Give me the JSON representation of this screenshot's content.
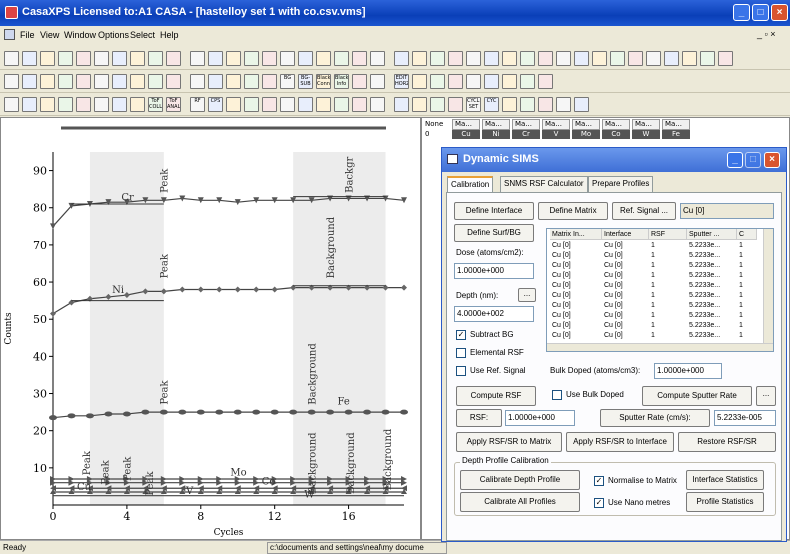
{
  "window": {
    "title": "CasaXPS Licensed to:A1 CASA - [hastelloy set 1 with co.csv.vms]"
  },
  "menu": [
    "File",
    "View",
    "Window",
    "Options",
    "Select",
    "Help"
  ],
  "status": {
    "left": "Ready",
    "path": "c:\\documents and settings\\neal\\my docume"
  },
  "toolbar_text": {
    "rsf": "RF",
    "cps": "CPS",
    "bg": "BG",
    "bgsub": "BG-SUB",
    "black_conn": "Black Conn",
    "black_info": "Black Info",
    "edit_horz": "EDIT HORZ",
    "tof_coll": "ToF COLL",
    "tof_anal": "ToF ANAL",
    "cycle_set": "CYCLE SET",
    "cyc": "CYC"
  },
  "colors": {
    "accent": "#0a3fb8",
    "chart_band": "#ececec",
    "line": "#555555"
  },
  "data_table": {
    "row_label": "None",
    "row_index": "0",
    "columns": [
      {
        "header": "Ma...",
        "sub": "Cu"
      },
      {
        "header": "Ma...",
        "sub": "Ni"
      },
      {
        "header": "Ma...",
        "sub": "Cr"
      },
      {
        "header": "Ma...",
        "sub": "V"
      },
      {
        "header": "Ma...",
        "sub": "Mo"
      },
      {
        "header": "Ma...",
        "sub": "Co"
      },
      {
        "header": "Ma...",
        "sub": "W"
      },
      {
        "header": "Ma...",
        "sub": "Fe"
      }
    ]
  },
  "dialog": {
    "title": "Dynamic SIMS",
    "tabs": [
      "Calibration",
      "SNMS RSF Calculator",
      "Prepare Profiles"
    ],
    "buttons": {
      "define_interface": "Define Interface",
      "define_matrix": "Define Matrix",
      "ref_signal": "Ref. Signal ...",
      "define_surf_bg": "Define Surf/BG",
      "depth_more": "...",
      "compute_rsf": "Compute RSF",
      "compute_sputter": "Compute Sputter Rate",
      "more": "...",
      "rsf": "RSF:",
      "apply_matrix": "Apply RSF/SR to Matrix",
      "apply_interface": "Apply RSF/SR to Interface",
      "restore": "Restore RSF/SR",
      "calibrate_depth": "Calibrate Depth Profile",
      "calibrate_all": "Calibrate All Profiles",
      "interface_stats": "Interface Statistics",
      "profile_stats": "Profile Statistics"
    },
    "ref_signal_value": "Cu [0]",
    "dose_label": "Dose (atoms/cm2):",
    "dose_value": "1.0000e+000",
    "depth_label": "Depth (nm):",
    "depth_value": "4.0000e+002",
    "checks": {
      "subtract_bg": "Subtract BG",
      "elemental_rsf": "Elemental RSF",
      "use_ref_signal": "Use Ref. Signal",
      "use_bulk_doped": "Use Bulk Doped",
      "normalise": "Normalise to Matrix",
      "nano": "Use Nano metres"
    },
    "check_states": {
      "subtract_bg": "✓",
      "elemental_rsf": "",
      "use_ref_signal": "",
      "use_bulk_doped": "",
      "normalise": "✓",
      "nano": "✓"
    },
    "bulk_label": "Bulk Doped (atoms/cm3):",
    "bulk_value": "1.0000e+000",
    "rsf_value": "1.0000e+000",
    "sputter_label": "Sputter Rate (cm/s):",
    "sputter_value": "5.2233e-005",
    "group_label": "Depth Profile Calibration",
    "table": {
      "headers": [
        "Matrix In...",
        "Interface",
        "RSF",
        "Sputter ...",
        "C"
      ],
      "rows": [
        [
          "Cu [0]",
          "Cu [0]",
          "1",
          "5.2233e...",
          "1"
        ],
        [
          "Cu [0]",
          "Cu [0]",
          "1",
          "5.2233e...",
          "1"
        ],
        [
          "Cu [0]",
          "Cu [0]",
          "1",
          "5.2233e...",
          "1"
        ],
        [
          "Cu [0]",
          "Cu [0]",
          "1",
          "5.2233e...",
          "1"
        ],
        [
          "Cu [0]",
          "Cu [0]",
          "1",
          "5.2233e...",
          "1"
        ],
        [
          "Cu [0]",
          "Cu [0]",
          "1",
          "5.2233e...",
          "1"
        ],
        [
          "Cu [0]",
          "Cu [0]",
          "1",
          "5.2233e...",
          "1"
        ],
        [
          "Cu [0]",
          "Cu [0]",
          "1",
          "5.2233e...",
          "1"
        ],
        [
          "Cu [0]",
          "Cu [0]",
          "1",
          "5.2233e...",
          "1"
        ],
        [
          "Cu [0]",
          "Cu [0]",
          "1",
          "5.2233e...",
          "1"
        ]
      ]
    }
  },
  "chart_data": {
    "type": "line",
    "title": "",
    "xlabel": "Cycles",
    "ylabel": "Counts",
    "xlim": [
      0,
      19
    ],
    "ylim": [
      0,
      95
    ],
    "xticks": [
      0,
      4,
      8,
      12,
      16
    ],
    "yticks": [
      10,
      20,
      30,
      40,
      50,
      60,
      70,
      80,
      90
    ],
    "bands": [
      [
        2,
        6
      ],
      [
        13,
        18
      ]
    ],
    "series": [
      {
        "name": "Cr",
        "marker": "triangle-down",
        "x": [
          0,
          1,
          2,
          3,
          4,
          5,
          6,
          7,
          8,
          9,
          10,
          11,
          12,
          13,
          14,
          15,
          16,
          17,
          18,
          19
        ],
        "values": [
          75,
          80.5,
          81,
          81.5,
          81.5,
          82,
          82,
          82.5,
          82,
          82,
          81.5,
          82,
          82,
          82,
          82,
          82.5,
          82.5,
          82.5,
          82.5,
          82
        ]
      },
      {
        "name": "Ni",
        "marker": "diamond",
        "x": [
          0,
          1,
          2,
          3,
          4,
          5,
          6,
          7,
          8,
          9,
          10,
          11,
          12,
          13,
          14,
          15,
          16,
          17,
          18,
          19
        ],
        "values": [
          51.5,
          54.5,
          55.5,
          56,
          56.5,
          57.5,
          57.5,
          58,
          58,
          58,
          58,
          58,
          58,
          58.5,
          58.5,
          58.5,
          58.5,
          58.5,
          58.5,
          58.5
        ]
      },
      {
        "name": "Fe",
        "marker": "dot",
        "x": [
          0,
          1,
          2,
          3,
          4,
          5,
          6,
          7,
          8,
          9,
          10,
          11,
          12,
          13,
          14,
          15,
          16,
          17,
          18,
          19
        ],
        "values": [
          23.5,
          24,
          24,
          24.5,
          24.5,
          25,
          25,
          25,
          25,
          25,
          25,
          25,
          25,
          25,
          25,
          25,
          25,
          25,
          25,
          25
        ]
      },
      {
        "name": "Mo",
        "marker": "triangle-right",
        "x": [
          0,
          1,
          2,
          3,
          4,
          5,
          6,
          7,
          8,
          9,
          10,
          11,
          12,
          13,
          14,
          15,
          16,
          17,
          18,
          19
        ],
        "values": [
          7,
          7,
          7,
          7,
          7,
          7,
          7,
          7,
          7,
          7,
          7,
          7,
          7,
          7,
          7,
          7,
          7,
          7,
          7,
          7
        ]
      },
      {
        "name": "Co",
        "marker": "triangle-right",
        "x": [
          0,
          1,
          2,
          3,
          4,
          5,
          6,
          7,
          8,
          9,
          10,
          11,
          12,
          13,
          14,
          15,
          16,
          17,
          18,
          19
        ],
        "values": [
          6,
          6,
          6,
          6,
          6,
          6,
          6,
          6,
          6,
          6,
          6,
          6,
          6,
          6,
          6,
          6,
          6,
          6,
          6,
          6
        ]
      },
      {
        "name": "Cu",
        "marker": "triangle-left",
        "x": [
          0,
          1,
          2,
          3,
          4,
          5,
          6,
          7,
          8,
          9,
          10,
          11,
          12,
          13,
          14,
          15,
          16,
          17,
          18,
          19
        ],
        "values": [
          4.5,
          4.5,
          4.5,
          4.5,
          4.5,
          4.5,
          4.5,
          4.5,
          4.5,
          4.5,
          4.5,
          4.5,
          4.5,
          4.5,
          4.5,
          4.5,
          4.5,
          4.5,
          4.5,
          4.5
        ]
      },
      {
        "name": "V",
        "marker": "triangle-up",
        "x": [
          0,
          1,
          2,
          3,
          4,
          5,
          6,
          7,
          8,
          9,
          10,
          11,
          12,
          13,
          14,
          15,
          16,
          17,
          18,
          19
        ],
        "values": [
          3.5,
          3.5,
          3.5,
          3.5,
          3.5,
          3.5,
          3.5,
          3.5,
          3.5,
          3.5,
          3.5,
          3.5,
          3.5,
          3.5,
          3.5,
          3.5,
          3.5,
          3.5,
          3.5,
          3.5
        ]
      },
      {
        "name": "W",
        "marker": "none",
        "x": [
          0,
          1,
          2,
          3,
          4,
          5,
          6,
          7,
          8,
          9,
          10,
          11,
          12,
          13,
          14,
          15,
          16,
          17,
          18,
          19
        ],
        "values": [
          2.5,
          2.5,
          2.5,
          2.5,
          2.5,
          2.5,
          2.5,
          2.5,
          2.5,
          2.5,
          2.5,
          2.5,
          2.5,
          2.5,
          2.5,
          2.5,
          2.5,
          2.5,
          2.5,
          2.5
        ]
      }
    ],
    "annotations": [
      {
        "text": "Cr",
        "x": 3.7,
        "y": 82,
        "rotate": 0
      },
      {
        "text": "Peak",
        "x": 6.2,
        "y": 84,
        "rotate": -90
      },
      {
        "text": "Backgr",
        "x": 16.2,
        "y": 84,
        "rotate": -90
      },
      {
        "text": "Ni",
        "x": 3.2,
        "y": 57,
        "rotate": 0
      },
      {
        "text": "Peak",
        "x": 6.2,
        "y": 61,
        "rotate": -90
      },
      {
        "text": "Background",
        "x": 15.2,
        "y": 61,
        "rotate": -90
      },
      {
        "text": "Peak",
        "x": 6.2,
        "y": 27,
        "rotate": -90
      },
      {
        "text": "Background",
        "x": 14.2,
        "y": 27,
        "rotate": -90
      },
      {
        "text": "Fe",
        "x": 15.4,
        "y": 27,
        "rotate": 0
      },
      {
        "text": "Peak",
        "x": 2.0,
        "y": 8,
        "rotate": -90
      },
      {
        "text": "Peak",
        "x": 3.0,
        "y": 5.5,
        "rotate": -90
      },
      {
        "text": "Peak",
        "x": 4.2,
        "y": 6.5,
        "rotate": -90
      },
      {
        "text": "Peak",
        "x": 5.4,
        "y": 2.5,
        "rotate": -90
      },
      {
        "text": "Mo",
        "x": 9.6,
        "y": 8,
        "rotate": 0
      },
      {
        "text": "Co",
        "x": 11.3,
        "y": 5.5,
        "rotate": 0
      },
      {
        "text": "Cu",
        "x": 1.3,
        "y": 4,
        "rotate": 0
      },
      {
        "text": "V",
        "x": 7.2,
        "y": 3,
        "rotate": 0
      },
      {
        "text": "W",
        "x": 13.6,
        "y": 2,
        "rotate": 0
      },
      {
        "text": "Background",
        "x": 14.2,
        "y": 3,
        "rotate": -90
      },
      {
        "text": "Background",
        "x": 16.3,
        "y": 3,
        "rotate": -90
      },
      {
        "text": "Background",
        "x": 18.3,
        "y": 4,
        "rotate": -90
      }
    ]
  }
}
